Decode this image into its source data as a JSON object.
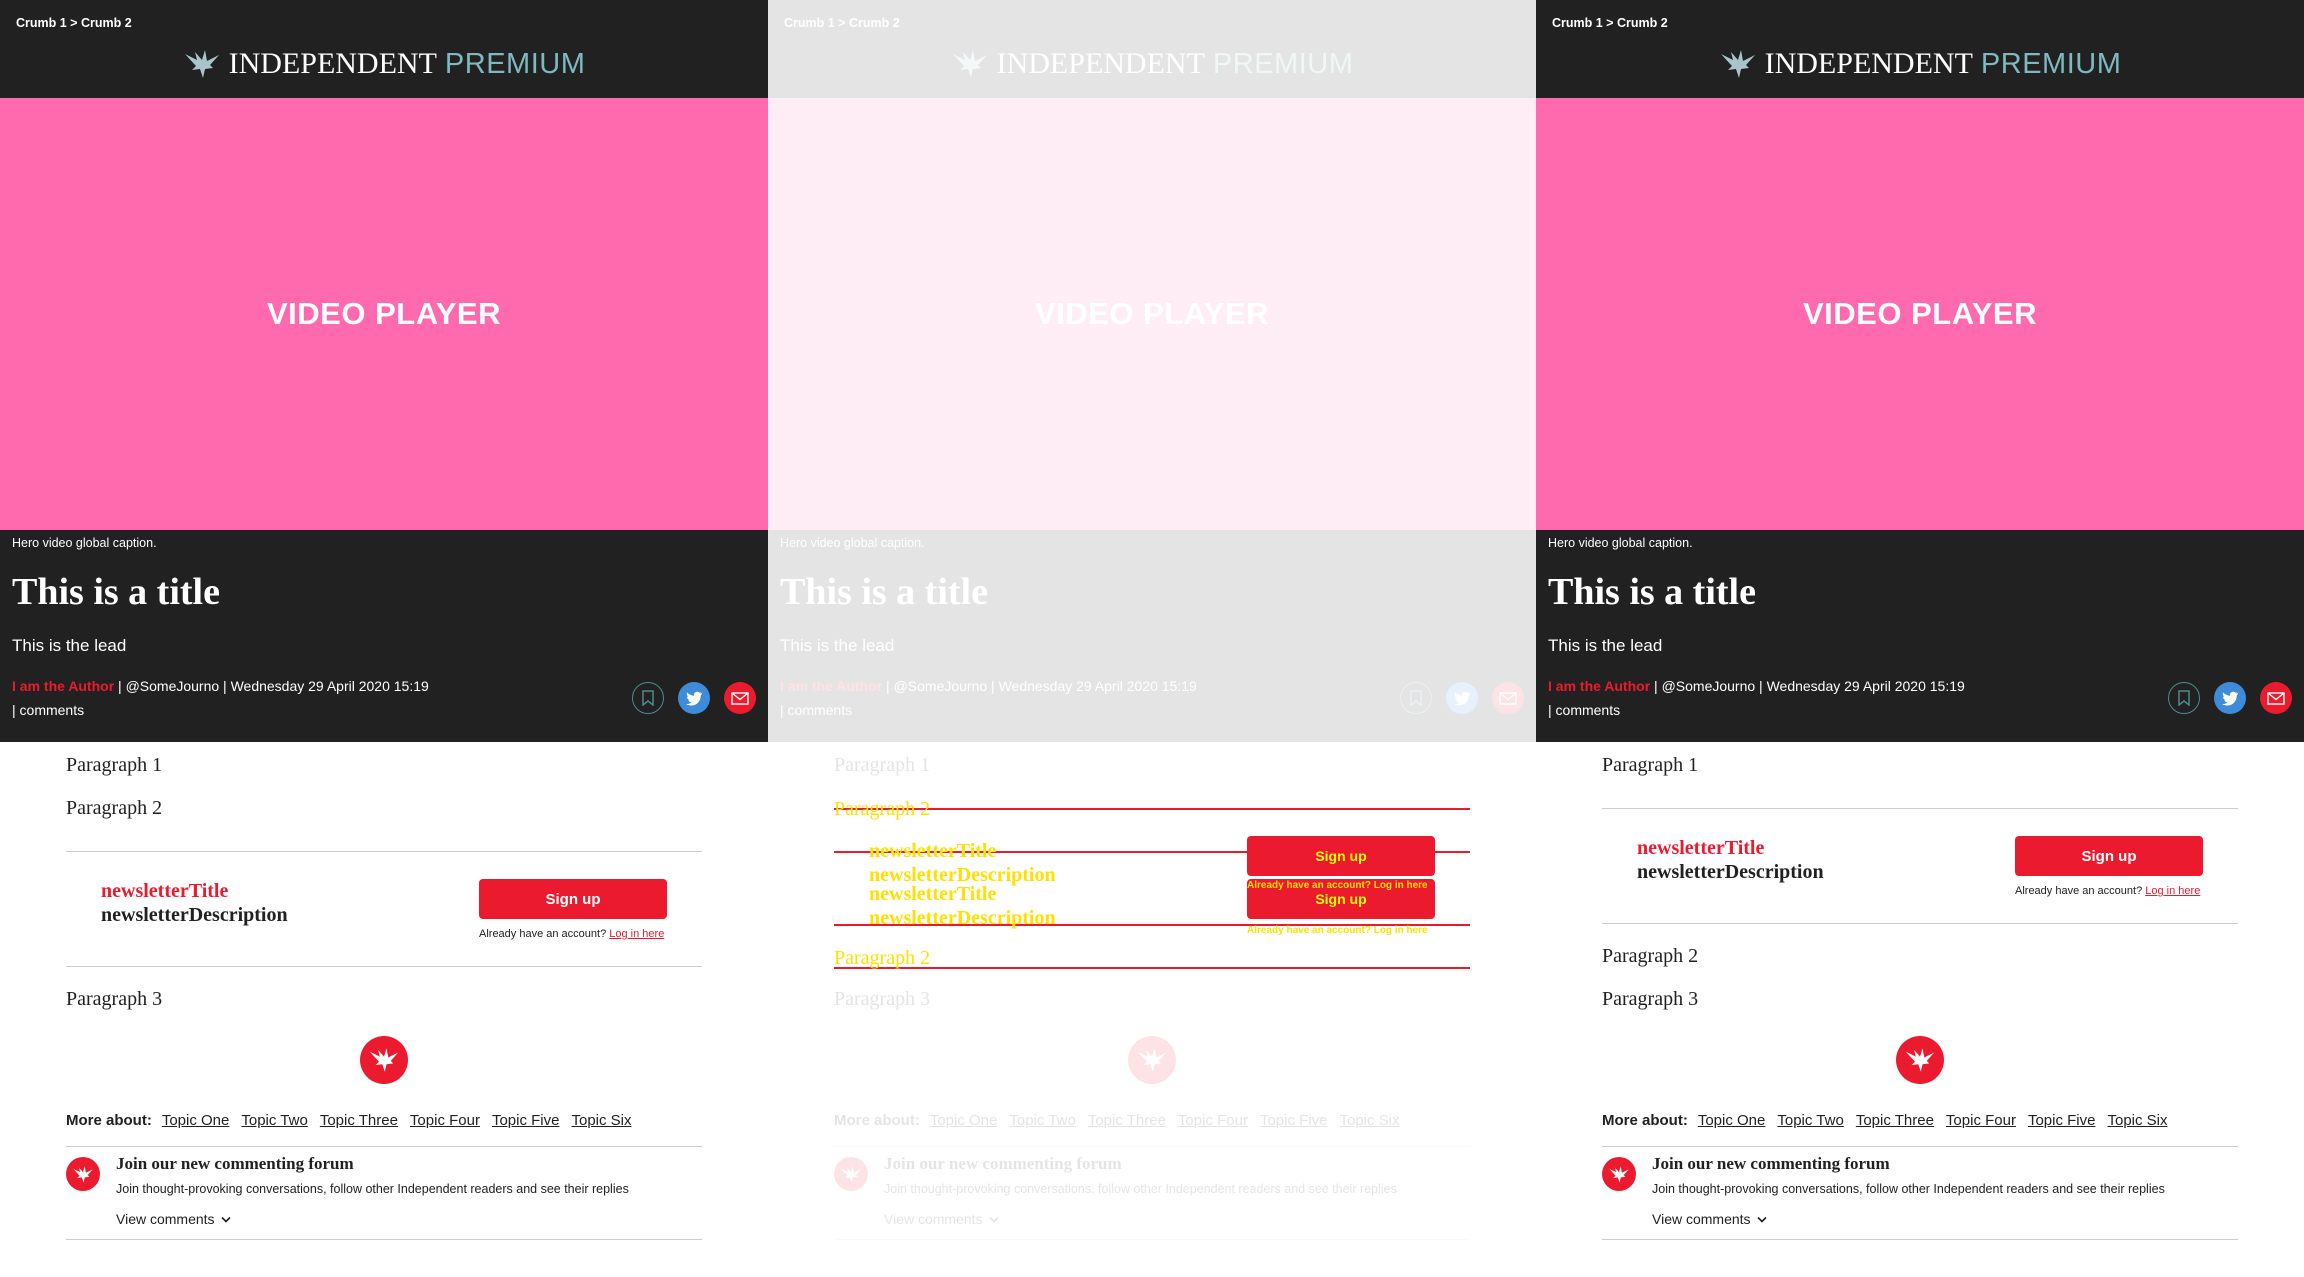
{
  "breadcrumb": "Crumb 1 > Crumb 2",
  "logo": {
    "brand": "INDEPENDENT",
    "premium": "PREMIUM"
  },
  "video_label": "VIDEO PLAYER",
  "caption": "Hero video global caption.",
  "title": "This is a title",
  "lead": "This is the lead",
  "author": "I am the Author",
  "byline_rest": " | @SomeJourno | Wednesday 29 April 2020 15:19",
  "comments_line": "|  comments",
  "paragraphs": [
    "Paragraph 1",
    "Paragraph 2",
    "Paragraph 3"
  ],
  "newsletter": {
    "title": "newsletterTitle",
    "description": "newsletterDescription",
    "signup": "Sign up",
    "account_text": "Already have an account?",
    "login_link": "Log in here"
  },
  "more_about": {
    "label": "More about:",
    "topics": [
      "Topic One",
      "Topic Two",
      "Topic Three",
      "Topic Four",
      "Topic Five",
      "Topic Six"
    ]
  },
  "comments_box": {
    "title": "Join our new commenting forum",
    "description": "Join thought-provoking conversations, follow other Independent readers and see their replies",
    "view": "View comments"
  },
  "colors": {
    "dark": "#212121",
    "accent": "#ec1a2e",
    "video": "#ff69ad",
    "premium": "#7fb8bd",
    "twitter": "#3d8bd9"
  },
  "icons": [
    "eagle-logo-icon",
    "bookmark-icon",
    "twitter-icon",
    "email-icon",
    "chevron-down-icon"
  ]
}
